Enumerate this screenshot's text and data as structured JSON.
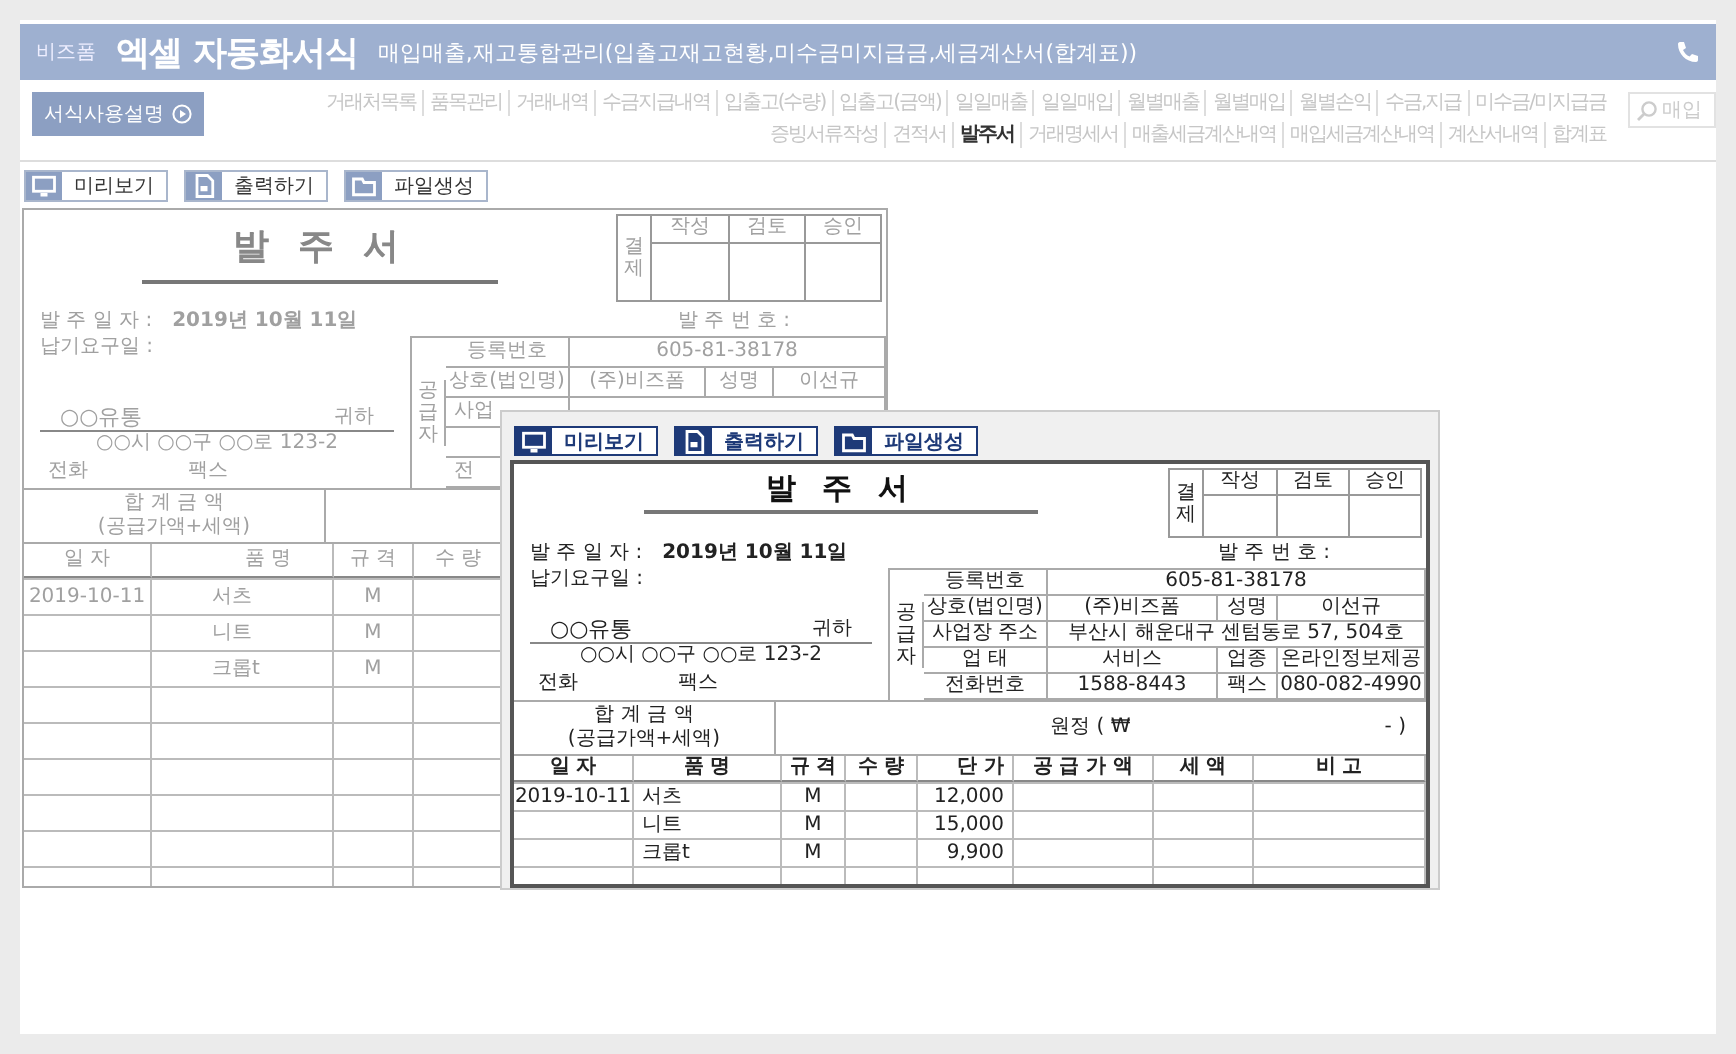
{
  "header": {
    "brand": "비즈폼",
    "title": "엑셀 자동화서식",
    "subtitle": "매입매출,재고통합관리(입출고재고현황,미수금미지급금,세금계산서(합계표))"
  },
  "guide_button": {
    "label": "서식사용설명"
  },
  "nav_rows": [
    [
      {
        "label": "거래처목록",
        "selected": false
      },
      {
        "label": "품목관리",
        "selected": false
      },
      {
        "label": "거래내역",
        "selected": false
      },
      {
        "label": "수금지급내역",
        "selected": false
      },
      {
        "label": "입출고(수량)",
        "selected": false
      },
      {
        "label": "입출고(금액)",
        "selected": false
      },
      {
        "label": "일일매출",
        "selected": false
      },
      {
        "label": "일일매입",
        "selected": false
      },
      {
        "label": "월별매출",
        "selected": false
      },
      {
        "label": "월별매입",
        "selected": false
      },
      {
        "label": "월별손익",
        "selected": false
      },
      {
        "label": "수금,지급",
        "selected": false
      },
      {
        "label": "미수금/미지급금",
        "selected": false
      }
    ],
    [
      {
        "label": "증빙서류작성",
        "selected": false
      },
      {
        "label": "견적서",
        "selected": false
      },
      {
        "label": "발주서",
        "selected": true
      },
      {
        "label": "거래명세서",
        "selected": false
      },
      {
        "label": "매출세금계산내역",
        "selected": false
      },
      {
        "label": "매입세금계산내역",
        "selected": false
      },
      {
        "label": "계산서내역",
        "selected": false
      },
      {
        "label": "합계표",
        "selected": false
      }
    ]
  ],
  "search": {
    "placeholder": "매입"
  },
  "toolbar": [
    {
      "label": "미리보기",
      "kind": "preview"
    },
    {
      "label": "출력하기",
      "kind": "print"
    },
    {
      "label": "파일생성",
      "kind": "file"
    }
  ],
  "back_form": {
    "title": "발 주 서",
    "approval": {
      "label": "결제",
      "columns": [
        "작성",
        "검토",
        "승인"
      ]
    },
    "order_date": {
      "label": "발 주 일 자 :",
      "value": "2019년 10월 11일"
    },
    "order_no": {
      "label": "발 주 번 호 :"
    },
    "due_date": {
      "label": "납기요구일 :"
    },
    "recipient": {
      "name": "○○유통",
      "honorific": "귀하",
      "address": "○○시 ○○구 ○○로 123-2",
      "phone": "전화",
      "fax": "팩스"
    },
    "supplier": {
      "label": "공급자",
      "rows": [
        [
          "등록번호",
          "605-81-38178"
        ],
        [
          "상호(법인명)",
          "(주)비즈폼",
          "성명",
          "이선규"
        ],
        [
          "사업"
        ],
        [],
        [
          "전"
        ]
      ]
    },
    "total": {
      "label": "합 계 금 액",
      "note": "(공급가액+세액)"
    },
    "columns": [
      "일 자",
      "품 명",
      "규 격",
      "수 량"
    ],
    "rows": [
      [
        "2019-10-11",
        "서츠",
        "M"
      ],
      [
        null,
        "니트",
        "M"
      ],
      [
        null,
        "크롭t",
        "M"
      ]
    ]
  },
  "front_window": {
    "toolbar": [
      {
        "label": "미리보기",
        "kind": "preview"
      },
      {
        "label": "출력하기",
        "kind": "print"
      },
      {
        "label": "파일생성",
        "kind": "file"
      }
    ],
    "form": {
      "title": "발 주 서",
      "approval": {
        "label": "결제",
        "columns": [
          "작성",
          "검토",
          "승인"
        ]
      },
      "order_date": {
        "label": "발 주 일 자 :",
        "value": "2019년 10월 11일"
      },
      "order_no": {
        "label": "발 주 번 호 :"
      },
      "due_date": {
        "label": "납기요구일 :"
      },
      "recipient": {
        "name": "○○유통",
        "honorific": "귀하",
        "address": "○○시 ○○구 ○○로 123-2",
        "phone": "전화",
        "fax": "팩스"
      },
      "supplier": {
        "label": "공급자",
        "rows": [
          [
            "등록번호",
            "605-81-38178"
          ],
          [
            "상호(법인명)",
            "(주)비즈폼",
            "성명",
            "이선규"
          ],
          [
            "사업장 주소",
            "부산시 해운대구 센텀동로 57, 504호"
          ],
          [
            "업 태",
            "서비스",
            "업종",
            "온라인정보제공"
          ],
          [
            "전화번호",
            "1588-8443",
            "팩스",
            "080-082-4990"
          ]
        ]
      },
      "total": {
        "label": "합 계 금 액",
        "note": "(공급가액+세액)",
        "amount": "원정 ( ₩",
        "end": "- )"
      },
      "columns": [
        "일 자",
        "품 명",
        "규 격",
        "수 량",
        "단 가",
        "공 급 가 액",
        "세 액",
        "비 고"
      ],
      "rows": [
        [
          "2019-10-11",
          "서츠",
          "M",
          null,
          "12,000"
        ],
        [
          null,
          "니트",
          "M",
          null,
          "15,000"
        ],
        [
          null,
          "크롭t",
          "M",
          null,
          "9,900"
        ]
      ]
    }
  }
}
